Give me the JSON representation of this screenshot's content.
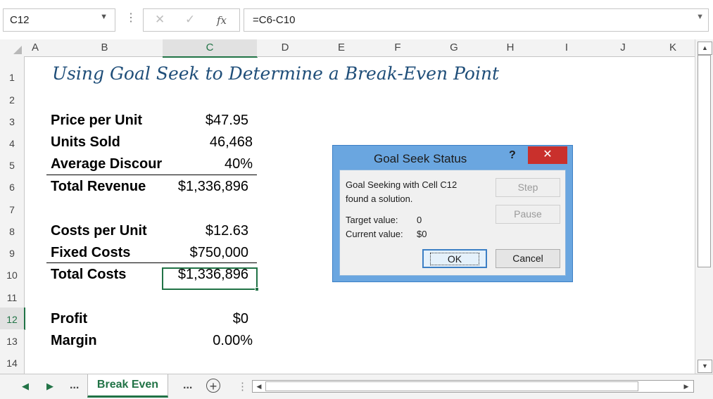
{
  "formula_bar": {
    "name_box": "C12",
    "cancel_icon": "✕",
    "enter_icon": "✓",
    "fx_icon": "fx",
    "formula": "=C6-C10"
  },
  "columns": [
    "A",
    "B",
    "C",
    "D",
    "E",
    "F",
    "G",
    "H",
    "I",
    "J",
    "K"
  ],
  "selected_column": "C",
  "rows": [
    "1",
    "2",
    "3",
    "4",
    "5",
    "6",
    "7",
    "8",
    "9",
    "10",
    "11",
    "12",
    "13",
    "14"
  ],
  "selected_row": "12",
  "sheet": {
    "title": "Using Goal Seek to Determine a Break-Even Point",
    "price_label": "Price per Unit",
    "price_value": "$47.95",
    "units_label": "Units Sold",
    "units_value": "46,468",
    "discount_label": "Average Discour",
    "discount_value": "40%",
    "revenue_label": "Total Revenue",
    "revenue_value": "$1,336,896",
    "cpu_label": "Costs per Unit",
    "cpu_value": "$12.63",
    "fixed_label": "Fixed Costs",
    "fixed_value": "$750,000",
    "costs_label": "Total Costs",
    "costs_value": "$1,336,896",
    "profit_label": "Profit",
    "profit_value": "$0",
    "margin_label": "Margin",
    "margin_value": "0.00%"
  },
  "dialog": {
    "title": "Goal Seek Status",
    "help": "?",
    "close": "✕",
    "message_line1": "Goal Seeking with Cell C12",
    "message_line2": "found a solution.",
    "target_label": "Target value:",
    "target_value": "0",
    "current_label": "Current value:",
    "current_value": "$0",
    "step_button": "Step",
    "pause_button": "Pause",
    "ok_button": "OK",
    "cancel_button": "Cancel"
  },
  "tabs": {
    "prev": "◀",
    "next": "▶",
    "more_left": "...",
    "active": "Break Even",
    "more_right": "...",
    "new_sheet": "+",
    "separator": "⋮"
  },
  "colors": {
    "accent": "#217346",
    "title": "#1f4e79",
    "dialog_frame": "#6aa6e0",
    "close": "#c9302c"
  }
}
